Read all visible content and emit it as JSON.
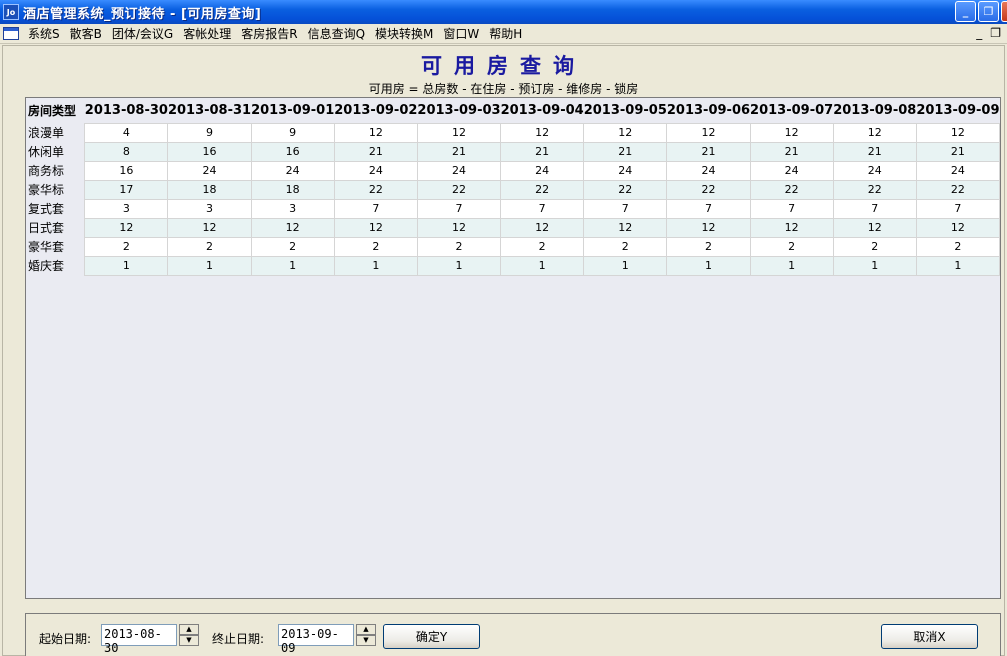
{
  "window": {
    "app_icon": "Jo",
    "title": "酒店管理系统_预订接待 - [可用房查询]",
    "buttons": {
      "minimize": "_",
      "restore": "❐"
    }
  },
  "menu": {
    "items": [
      "系统S",
      "散客B",
      "团体/会议G",
      "客帐处理",
      "客房报告R",
      "信息查询Q",
      "模块转换M",
      "窗口W",
      "帮助H"
    ],
    "right_controls": [
      "_",
      "❐"
    ]
  },
  "page": {
    "title": "可用房查询",
    "formula": "可用房 = 总房数 - 在住房 - 预订房 - 维修房 - 锁房"
  },
  "table": {
    "type_header": "房间类型",
    "dates": [
      "2013-08-30",
      "2013-08-31",
      "2013-09-01",
      "2013-09-02",
      "2013-09-03",
      "2013-09-04",
      "2013-09-05",
      "2013-09-06",
      "2013-09-07",
      "2013-09-08",
      "2013-09-09"
    ],
    "rows": [
      {
        "type": "浪漫单",
        "values": [
          4,
          9,
          9,
          12,
          12,
          12,
          12,
          12,
          12,
          12,
          12
        ]
      },
      {
        "type": "休闲单",
        "values": [
          8,
          16,
          16,
          21,
          21,
          21,
          21,
          21,
          21,
          21,
          21
        ]
      },
      {
        "type": "商务标",
        "values": [
          16,
          24,
          24,
          24,
          24,
          24,
          24,
          24,
          24,
          24,
          24
        ]
      },
      {
        "type": "豪华标",
        "values": [
          17,
          18,
          18,
          22,
          22,
          22,
          22,
          22,
          22,
          22,
          22
        ]
      },
      {
        "type": "复式套",
        "values": [
          3,
          3,
          3,
          7,
          7,
          7,
          7,
          7,
          7,
          7,
          7
        ]
      },
      {
        "type": "日式套",
        "values": [
          12,
          12,
          12,
          12,
          12,
          12,
          12,
          12,
          12,
          12,
          12
        ]
      },
      {
        "type": "豪华套",
        "values": [
          2,
          2,
          2,
          2,
          2,
          2,
          2,
          2,
          2,
          2,
          2
        ]
      },
      {
        "type": "婚庆套",
        "values": [
          1,
          1,
          1,
          1,
          1,
          1,
          1,
          1,
          1,
          1,
          1
        ]
      }
    ]
  },
  "controls": {
    "start_label": "起始日期:",
    "start_value": "2013-08-30",
    "end_label": "终止日期:",
    "end_value": "2013-09-09",
    "confirm_label": "确定Y",
    "cancel_label": "取消X",
    "spin_up": "▲",
    "spin_down": "▼"
  }
}
